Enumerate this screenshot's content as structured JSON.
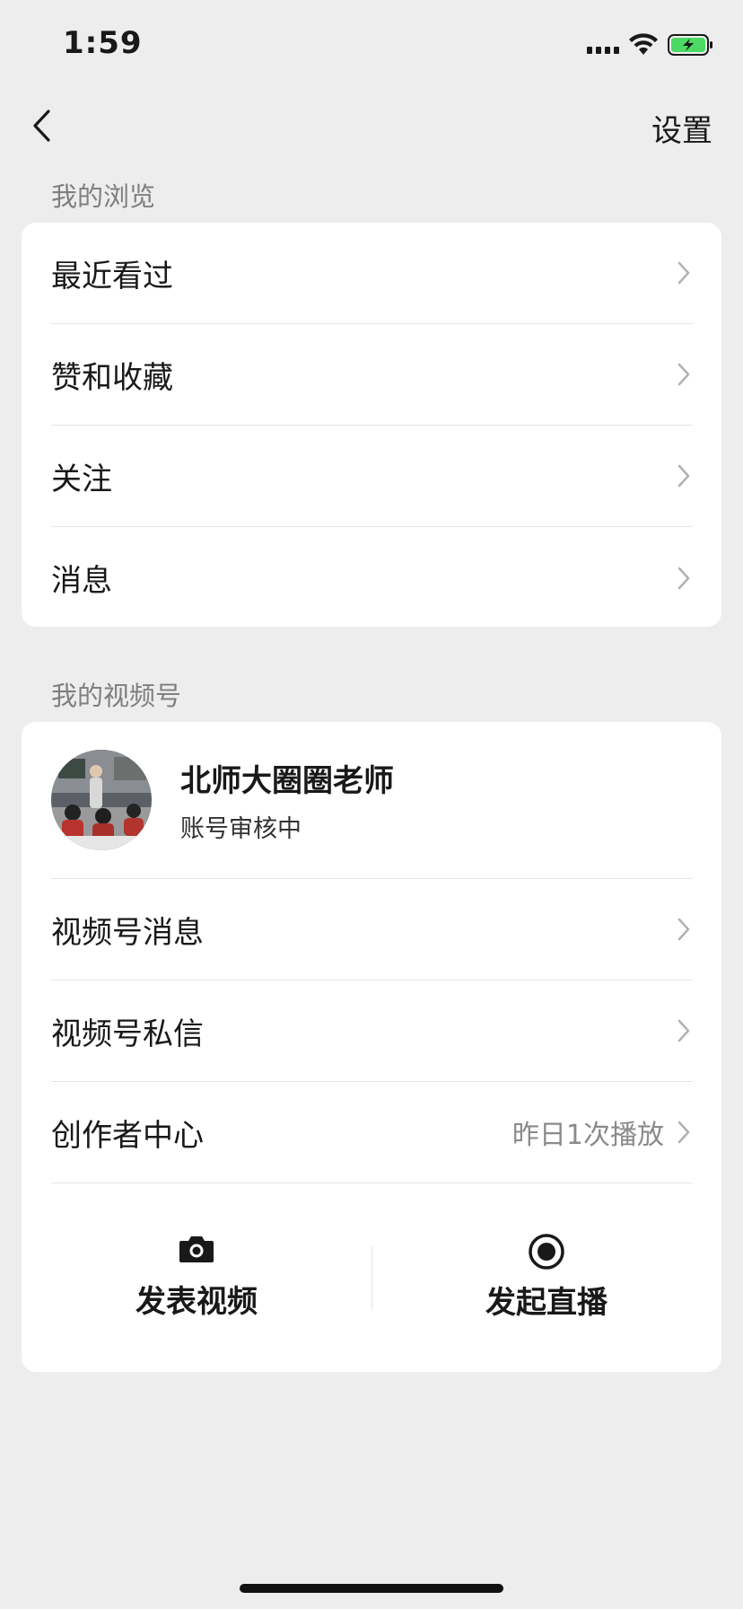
{
  "status_bar": {
    "time": "1:59"
  },
  "nav": {
    "settings_label": "设置"
  },
  "browsing": {
    "section_title": "我的浏览",
    "items": [
      {
        "label": "最近看过"
      },
      {
        "label": "赞和收藏"
      },
      {
        "label": "关注"
      },
      {
        "label": "消息"
      }
    ]
  },
  "channels": {
    "section_title": "我的视频号",
    "profile": {
      "name": "北师大圈圈老师",
      "status": "账号审核中"
    },
    "items": [
      {
        "label": "视频号消息",
        "extra": ""
      },
      {
        "label": "视频号私信",
        "extra": ""
      },
      {
        "label": "创作者中心",
        "extra": "昨日1次播放"
      }
    ],
    "actions": {
      "post_video_label": "发表视频",
      "go_live_label": "发起直播"
    }
  },
  "colors": {
    "background": "#ededed",
    "card": "#ffffff",
    "battery_green": "#4cd964",
    "secondary_text": "#7f7f7f"
  },
  "icons": [
    "cellular-signal-icon",
    "wifi-icon",
    "battery-charging-icon",
    "back-chevron-icon",
    "chevron-right-icon",
    "camera-icon",
    "live-record-icon"
  ]
}
